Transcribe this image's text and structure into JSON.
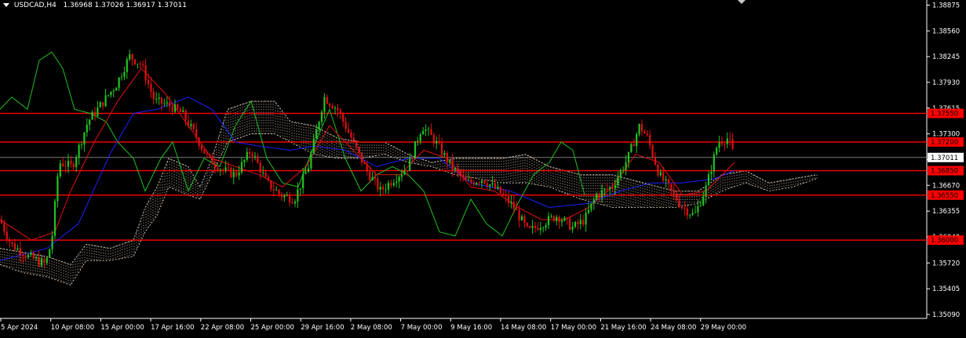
{
  "header": {
    "symbol": "USDCAD,H4",
    "ohlc": "1.36968 1.37026 1.36917 1.37011"
  },
  "colors": {
    "background": "#000000",
    "bull": "#22c322",
    "bear": "#e01010",
    "tenkan": "#e01010",
    "kijun": "#2020ff",
    "chikou": "#20c020",
    "cloud": "#f0dcc8",
    "level_line": "#ff0000",
    "axis": "#ffffff"
  },
  "chart_data": {
    "type": "candlestick",
    "title": "USDCAD,H4",
    "ylim": [
      1.3509,
      1.3888
    ],
    "price_ticks": [
      1.38875,
      1.3856,
      1.38245,
      1.3793,
      1.37615,
      1.373,
      1.36985,
      1.3667,
      1.36355,
      1.3604,
      1.3572,
      1.35405,
      1.3509
    ],
    "current_price": 1.37011,
    "levels": [
      1.3755,
      1.372,
      1.3685,
      1.3655,
      1.36
    ],
    "time_labels": [
      "5 Apr 2024",
      "10 Apr 08:00",
      "15 Apr 00:00",
      "17 Apr 16:00",
      "22 Apr 08:00",
      "25 Apr 00:00",
      "29 Apr 16:00",
      "2 May 08:00",
      "7 May 00:00",
      "9 May 16:00",
      "14 May 08:00",
      "17 May 00:00",
      "21 May 16:00",
      "24 May 08:00",
      "29 May 00:00"
    ],
    "price_path": [
      [
        0,
        1.3625
      ],
      [
        14,
        1.3595
      ],
      [
        36,
        1.358
      ],
      [
        58,
        1.357
      ],
      [
        66,
        1.36
      ],
      [
        75,
        1.3695
      ],
      [
        92,
        1.369
      ],
      [
        112,
        1.3745
      ],
      [
        128,
        1.3765
      ],
      [
        148,
        1.379
      ],
      [
        165,
        1.3825
      ],
      [
        180,
        1.3815
      ],
      [
        197,
        1.377
      ],
      [
        215,
        1.3765
      ],
      [
        232,
        1.3755
      ],
      [
        248,
        1.373
      ],
      [
        265,
        1.37
      ],
      [
        285,
        1.3685
      ],
      [
        300,
        1.368
      ],
      [
        320,
        1.371
      ],
      [
        340,
        1.367
      ],
      [
        358,
        1.3655
      ],
      [
        375,
        1.365
      ],
      [
        393,
        1.369
      ],
      [
        413,
        1.3775
      ],
      [
        430,
        1.376
      ],
      [
        450,
        1.372
      ],
      [
        467,
        1.3685
      ],
      [
        485,
        1.366
      ],
      [
        502,
        1.3675
      ],
      [
        520,
        1.369
      ],
      [
        538,
        1.374
      ],
      [
        555,
        1.372
      ],
      [
        575,
        1.369
      ],
      [
        595,
        1.367
      ],
      [
        615,
        1.3675
      ],
      [
        635,
        1.366
      ],
      [
        655,
        1.364
      ],
      [
        673,
        1.361
      ],
      [
        690,
        1.362
      ],
      [
        710,
        1.363
      ],
      [
        730,
        1.3615
      ],
      [
        745,
        1.3625
      ],
      [
        760,
        1.3655
      ],
      [
        780,
        1.3665
      ],
      [
        800,
        1.37
      ],
      [
        815,
        1.374
      ],
      [
        825,
        1.3725
      ],
      [
        840,
        1.368
      ],
      [
        855,
        1.366
      ],
      [
        870,
        1.364
      ],
      [
        885,
        1.363
      ],
      [
        900,
        1.3665
      ],
      [
        915,
        1.372
      ],
      [
        928,
        1.3725
      ],
      [
        936,
        1.3701
      ]
    ],
    "tenkan": [
      [
        0,
        1.3625
      ],
      [
        40,
        1.36
      ],
      [
        70,
        1.361
      ],
      [
        90,
        1.366
      ],
      [
        120,
        1.372
      ],
      [
        150,
        1.377
      ],
      [
        180,
        1.381
      ],
      [
        210,
        1.378
      ],
      [
        240,
        1.374
      ],
      [
        270,
        1.37
      ],
      [
        300,
        1.369
      ],
      [
        330,
        1.368
      ],
      [
        360,
        1.3665
      ],
      [
        390,
        1.369
      ],
      [
        420,
        1.374
      ],
      [
        450,
        1.371
      ],
      [
        480,
        1.368
      ],
      [
        510,
        1.368
      ],
      [
        540,
        1.371
      ],
      [
        570,
        1.37
      ],
      [
        600,
        1.3665
      ],
      [
        630,
        1.366
      ],
      [
        660,
        1.364
      ],
      [
        690,
        1.3625
      ],
      [
        720,
        1.3625
      ],
      [
        750,
        1.364
      ],
      [
        780,
        1.3665
      ],
      [
        810,
        1.3705
      ],
      [
        840,
        1.3695
      ],
      [
        870,
        1.3655
      ],
      [
        900,
        1.366
      ],
      [
        936,
        1.3695
      ]
    ],
    "kijun": [
      [
        0,
        1.3575
      ],
      [
        60,
        1.359
      ],
      [
        100,
        1.362
      ],
      [
        140,
        1.3705
      ],
      [
        170,
        1.3755
      ],
      [
        200,
        1.376
      ],
      [
        240,
        1.3775
      ],
      [
        270,
        1.376
      ],
      [
        300,
        1.372
      ],
      [
        330,
        1.3715
      ],
      [
        370,
        1.371
      ],
      [
        400,
        1.3715
      ],
      [
        440,
        1.371
      ],
      [
        480,
        1.369
      ],
      [
        520,
        1.37
      ],
      [
        560,
        1.37
      ],
      [
        600,
        1.367
      ],
      [
        650,
        1.366
      ],
      [
        700,
        1.364
      ],
      [
        750,
        1.3645
      ],
      [
        790,
        1.366
      ],
      [
        830,
        1.367
      ],
      [
        870,
        1.367
      ],
      [
        910,
        1.3675
      ],
      [
        936,
        1.3685
      ]
    ],
    "chikou": [
      [
        0,
        1.376
      ],
      [
        15,
        1.3775
      ],
      [
        35,
        1.376
      ],
      [
        50,
        1.382
      ],
      [
        66,
        1.383
      ],
      [
        80,
        1.381
      ],
      [
        95,
        1.376
      ],
      [
        115,
        1.3755
      ],
      [
        135,
        1.3745
      ],
      [
        150,
        1.372
      ],
      [
        170,
        1.37
      ],
      [
        185,
        1.366
      ],
      [
        205,
        1.37
      ],
      [
        220,
        1.372
      ],
      [
        240,
        1.366
      ],
      [
        260,
        1.37
      ],
      [
        280,
        1.369
      ],
      [
        300,
        1.374
      ],
      [
        320,
        1.377
      ],
      [
        340,
        1.37
      ],
      [
        360,
        1.367
      ],
      [
        380,
        1.3665
      ],
      [
        400,
        1.3715
      ],
      [
        420,
        1.376
      ],
      [
        440,
        1.37
      ],
      [
        460,
        1.366
      ],
      [
        480,
        1.368
      ],
      [
        500,
        1.369
      ],
      [
        520,
        1.368
      ],
      [
        540,
        1.366
      ],
      [
        560,
        1.361
      ],
      [
        580,
        1.3605
      ],
      [
        600,
        1.365
      ],
      [
        620,
        1.362
      ],
      [
        640,
        1.3605
      ],
      [
        660,
        1.3645
      ],
      [
        680,
        1.368
      ],
      [
        700,
        1.3695
      ],
      [
        715,
        1.372
      ],
      [
        730,
        1.371
      ],
      [
        745,
        1.3655
      ]
    ],
    "cloud_a": [
      [
        0,
        1.359
      ],
      [
        30,
        1.3585
      ],
      [
        60,
        1.358
      ],
      [
        90,
        1.357
      ],
      [
        110,
        1.3595
      ],
      [
        140,
        1.359
      ],
      [
        170,
        1.36
      ],
      [
        185,
        1.364
      ],
      [
        200,
        1.3665
      ],
      [
        215,
        1.37
      ],
      [
        240,
        1.369
      ],
      [
        255,
        1.3665
      ],
      [
        270,
        1.37
      ],
      [
        290,
        1.376
      ],
      [
        320,
        1.377
      ],
      [
        350,
        1.377
      ],
      [
        370,
        1.3745
      ],
      [
        400,
        1.374
      ],
      [
        430,
        1.3725
      ],
      [
        460,
        1.372
      ],
      [
        490,
        1.372
      ],
      [
        520,
        1.3705
      ],
      [
        550,
        1.3695
      ],
      [
        580,
        1.37
      ],
      [
        610,
        1.37
      ],
      [
        640,
        1.37
      ],
      [
        670,
        1.3705
      ],
      [
        700,
        1.369
      ],
      [
        740,
        1.368
      ],
      [
        780,
        1.368
      ],
      [
        820,
        1.367
      ],
      [
        860,
        1.366
      ],
      [
        890,
        1.366
      ],
      [
        920,
        1.368
      ],
      [
        950,
        1.3685
      ],
      [
        980,
        1.367
      ],
      [
        1010,
        1.3675
      ],
      [
        1040,
        1.368
      ]
    ],
    "cloud_b": [
      [
        0,
        1.357
      ],
      [
        30,
        1.356
      ],
      [
        60,
        1.3555
      ],
      [
        90,
        1.3545
      ],
      [
        110,
        1.3575
      ],
      [
        140,
        1.3575
      ],
      [
        170,
        1.358
      ],
      [
        185,
        1.361
      ],
      [
        200,
        1.363
      ],
      [
        215,
        1.3665
      ],
      [
        240,
        1.3655
      ],
      [
        255,
        1.365
      ],
      [
        270,
        1.368
      ],
      [
        290,
        1.372
      ],
      [
        320,
        1.373
      ],
      [
        350,
        1.373
      ],
      [
        370,
        1.372
      ],
      [
        400,
        1.3705
      ],
      [
        430,
        1.37
      ],
      [
        460,
        1.37
      ],
      [
        490,
        1.3705
      ],
      [
        520,
        1.3695
      ],
      [
        550,
        1.369
      ],
      [
        580,
        1.368
      ],
      [
        610,
        1.3675
      ],
      [
        640,
        1.367
      ],
      [
        670,
        1.367
      ],
      [
        700,
        1.3665
      ],
      [
        740,
        1.365
      ],
      [
        780,
        1.364
      ],
      [
        820,
        1.364
      ],
      [
        860,
        1.364
      ],
      [
        890,
        1.3645
      ],
      [
        920,
        1.366
      ],
      [
        950,
        1.367
      ],
      [
        980,
        1.366
      ],
      [
        1010,
        1.3665
      ],
      [
        1040,
        1.3675
      ]
    ]
  }
}
